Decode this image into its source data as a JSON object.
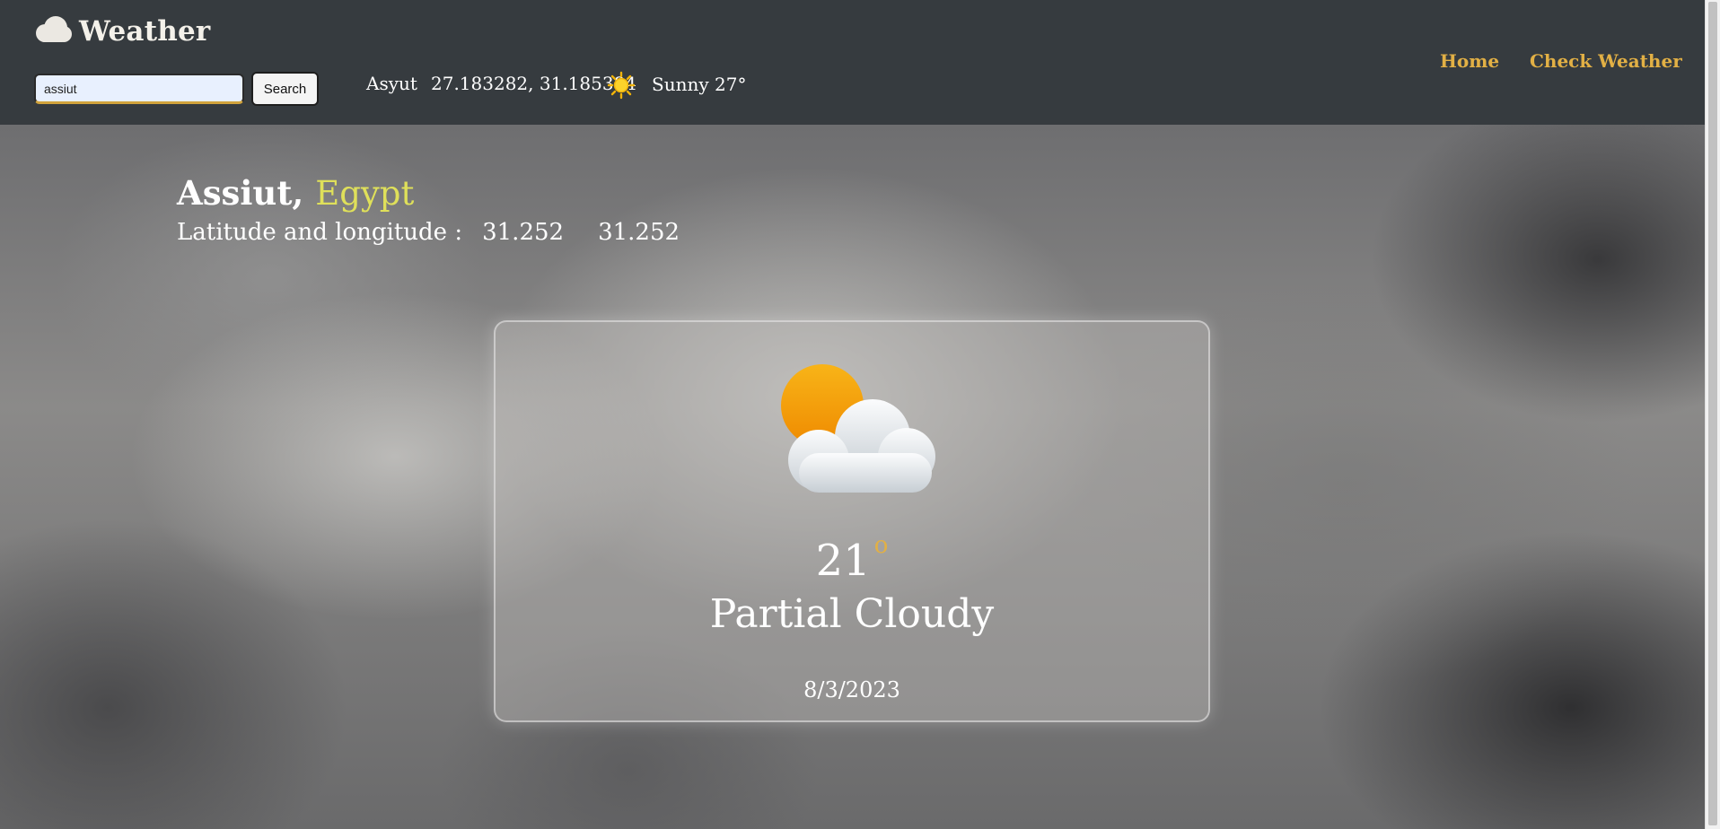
{
  "header": {
    "brand": "Weather",
    "search": {
      "value": "assiut",
      "button_label": "Search"
    },
    "current": {
      "name": "Asyut",
      "coords": "27.183282, 31.185384",
      "icon": "sun-icon",
      "weather": "Sunny 27°"
    },
    "nav": {
      "home": "Home",
      "check": "Check Weather"
    }
  },
  "location": {
    "city": "Assiut,",
    "country": "Egypt",
    "latlon_label": "Latitude and longitude :",
    "lat": "31.252",
    "lon": "31.252"
  },
  "card": {
    "icon": "partly-cloudy-icon",
    "temp": "21",
    "deg": "o",
    "condition": "Partial Cloudy",
    "date": "8/3/2023"
  },
  "colors": {
    "accent": "#e2b045",
    "country": "#dfe05a",
    "header_bg": "#363b3f"
  }
}
